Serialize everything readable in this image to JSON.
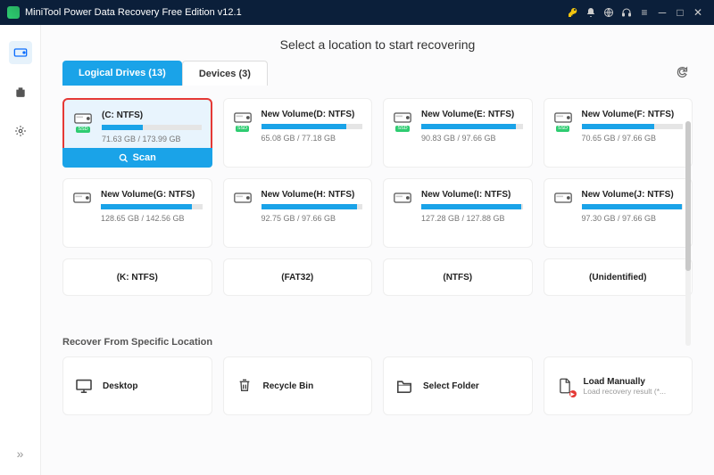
{
  "title": "MiniTool Power Data Recovery Free Edition v12.1",
  "headline": "Select a location to start recovering",
  "tabs": {
    "logical": "Logical Drives (13)",
    "devices": "Devices (3)"
  },
  "scan_label": "Scan",
  "drives": [
    {
      "name": "(C: NTFS)",
      "usage": "71.63 GB / 173.99 GB",
      "pct": 41,
      "ssd": true,
      "selected": true
    },
    {
      "name": "New Volume(D: NTFS)",
      "usage": "65.08 GB / 77.18 GB",
      "pct": 84,
      "ssd": true
    },
    {
      "name": "New Volume(E: NTFS)",
      "usage": "90.83 GB / 97.66 GB",
      "pct": 93,
      "ssd": true
    },
    {
      "name": "New Volume(F: NTFS)",
      "usage": "70.65 GB / 97.66 GB",
      "pct": 72,
      "ssd": true
    },
    {
      "name": "New Volume(G: NTFS)",
      "usage": "128.65 GB / 142.56 GB",
      "pct": 90
    },
    {
      "name": "New Volume(H: NTFS)",
      "usage": "92.75 GB / 97.66 GB",
      "pct": 95
    },
    {
      "name": "New Volume(I: NTFS)",
      "usage": "127.28 GB / 127.88 GB",
      "pct": 99
    },
    {
      "name": "New Volume(J: NTFS)",
      "usage": "97.30 GB / 97.66 GB",
      "pct": 99
    }
  ],
  "short_drives": [
    {
      "name": "(K: NTFS)"
    },
    {
      "name": "(FAT32)"
    },
    {
      "name": "(NTFS)"
    },
    {
      "name": "(Unidentified)"
    }
  ],
  "section_title": "Recover From Specific Location",
  "locations": {
    "desktop": "Desktop",
    "recycle": "Recycle Bin",
    "folder": "Select Folder",
    "manual": "Load Manually",
    "manual_sub": "Load recovery result (*..."
  }
}
